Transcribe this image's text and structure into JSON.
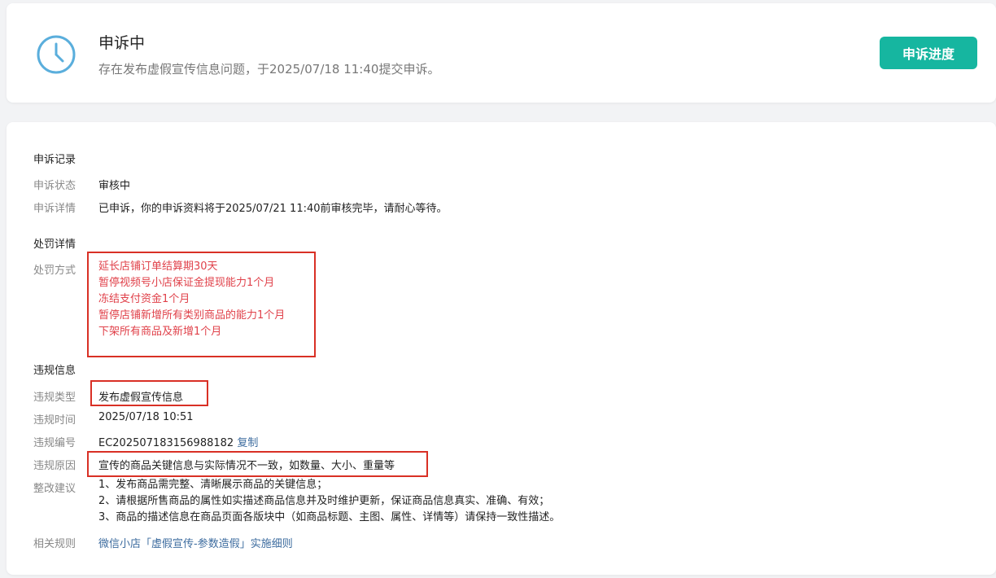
{
  "status": {
    "title": "申诉中",
    "description": "存在发布虚假宣传信息问题，于2025/07/18 11:40提交申诉。",
    "button_label": "申诉进度",
    "accent_color": "#16b6a0",
    "icon": "clock-icon"
  },
  "appeal_record": {
    "section_title": "申诉记录",
    "status_label": "申诉状态",
    "status_value": "审核中",
    "detail_label": "申诉详情",
    "detail_value": "已申诉，你的申诉资料将于2025/07/21 11:40前审核完毕，请耐心等待。"
  },
  "penalty": {
    "section_title": "处罚详情",
    "method_label": "处罚方式",
    "methods": [
      "延长店铺订单结算期30天",
      "暂停视频号小店保证金提现能力1个月",
      "冻结支付资金1个月",
      "暂停店铺新增所有类别商品的能力1个月",
      "下架所有商品及新增1个月"
    ]
  },
  "violation": {
    "section_title": "违规信息",
    "type_label": "违规类型",
    "type_value": "发布虚假宣传信息",
    "time_label": "违规时间",
    "time_value": "2025/07/18 10:51",
    "id_label": "违规编号",
    "id_value": "EC202507183156988182",
    "copy_label": "复制",
    "reason_label": "违规原因",
    "reason_value": "宣传的商品关键信息与实际情况不一致，如数量、大小、重量等",
    "suggestion_label": "整改建议",
    "suggestions": [
      "1、发布商品需完整、清晰展示商品的关键信息；",
      "2、请根据所售商品的属性如实描述商品信息并及时维护更新，保证商品信息真实、准确、有效；",
      "3、商品的描述信息在商品页面各版块中（如商品标题、主图、属性、详情等）请保持一致性描述。"
    ],
    "rule_label": "相关规则",
    "rule_link": "微信小店「虚假宣传-参数造假」实施细则"
  }
}
